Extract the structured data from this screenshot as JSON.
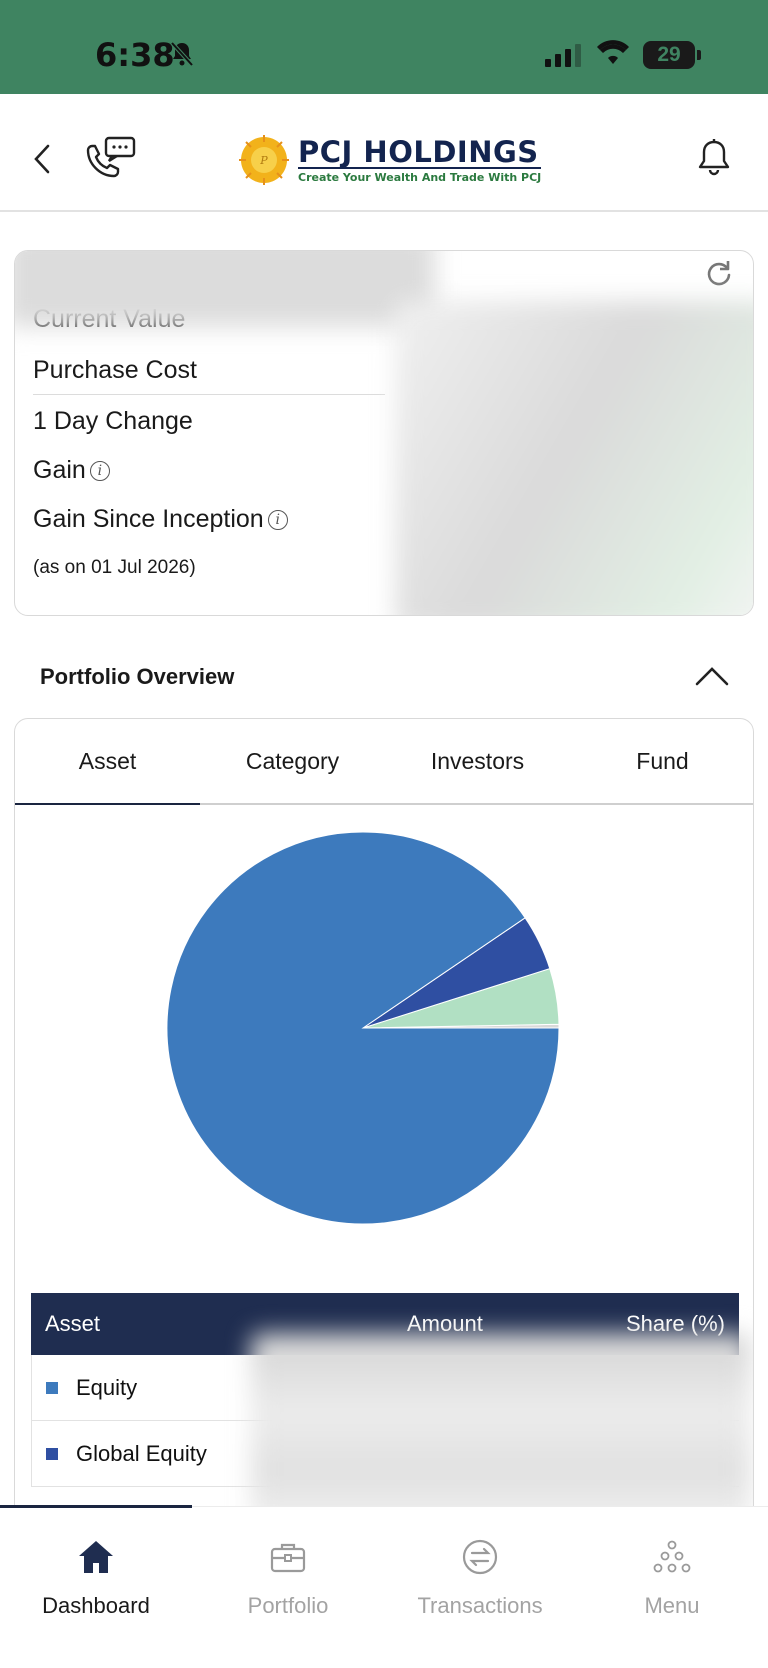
{
  "status_bar": {
    "time": "6:38",
    "battery": "29"
  },
  "header": {
    "brand_name": "PCJ HOLDINGS",
    "tagline": "Create Your Wealth And Trade With PCJ"
  },
  "summary": {
    "rows": [
      "Current Value",
      "Purchase Cost",
      "1 Day Change",
      "Gain",
      "Gain Since Inception"
    ],
    "as_of": "(as on 01 Jul 2026)"
  },
  "overview": {
    "title": "Portfolio Overview",
    "tabs": [
      "Asset",
      "Category",
      "Investors",
      "Fund"
    ],
    "active_tab": "Asset"
  },
  "chart_data": {
    "type": "pie",
    "slices": [
      {
        "label": "Equity",
        "value": 90.5,
        "color": "#3d7abd"
      },
      {
        "label": "Global Equity",
        "value": 4.6,
        "color": "#2f4fa2"
      },
      {
        "label": "",
        "value": 4.6,
        "color": "#b1e0c3"
      },
      {
        "label": "",
        "value": 0.3,
        "color": "#d9d9d9"
      }
    ]
  },
  "table": {
    "headers": [
      "Asset",
      "Amount",
      "Share (%)"
    ],
    "rows": [
      {
        "label": "Equity",
        "color": "#3d7abd"
      },
      {
        "label": "Global Equity",
        "color": "#2f4fa2"
      }
    ]
  },
  "bottom_nav": {
    "items": [
      "Dashboard",
      "Portfolio",
      "Transactions",
      "Menu"
    ],
    "active": "Dashboard"
  },
  "colors": {
    "status_bar": "#3f8461",
    "navy": "#1f2d50",
    "accent_green": "#2b7a3f"
  }
}
